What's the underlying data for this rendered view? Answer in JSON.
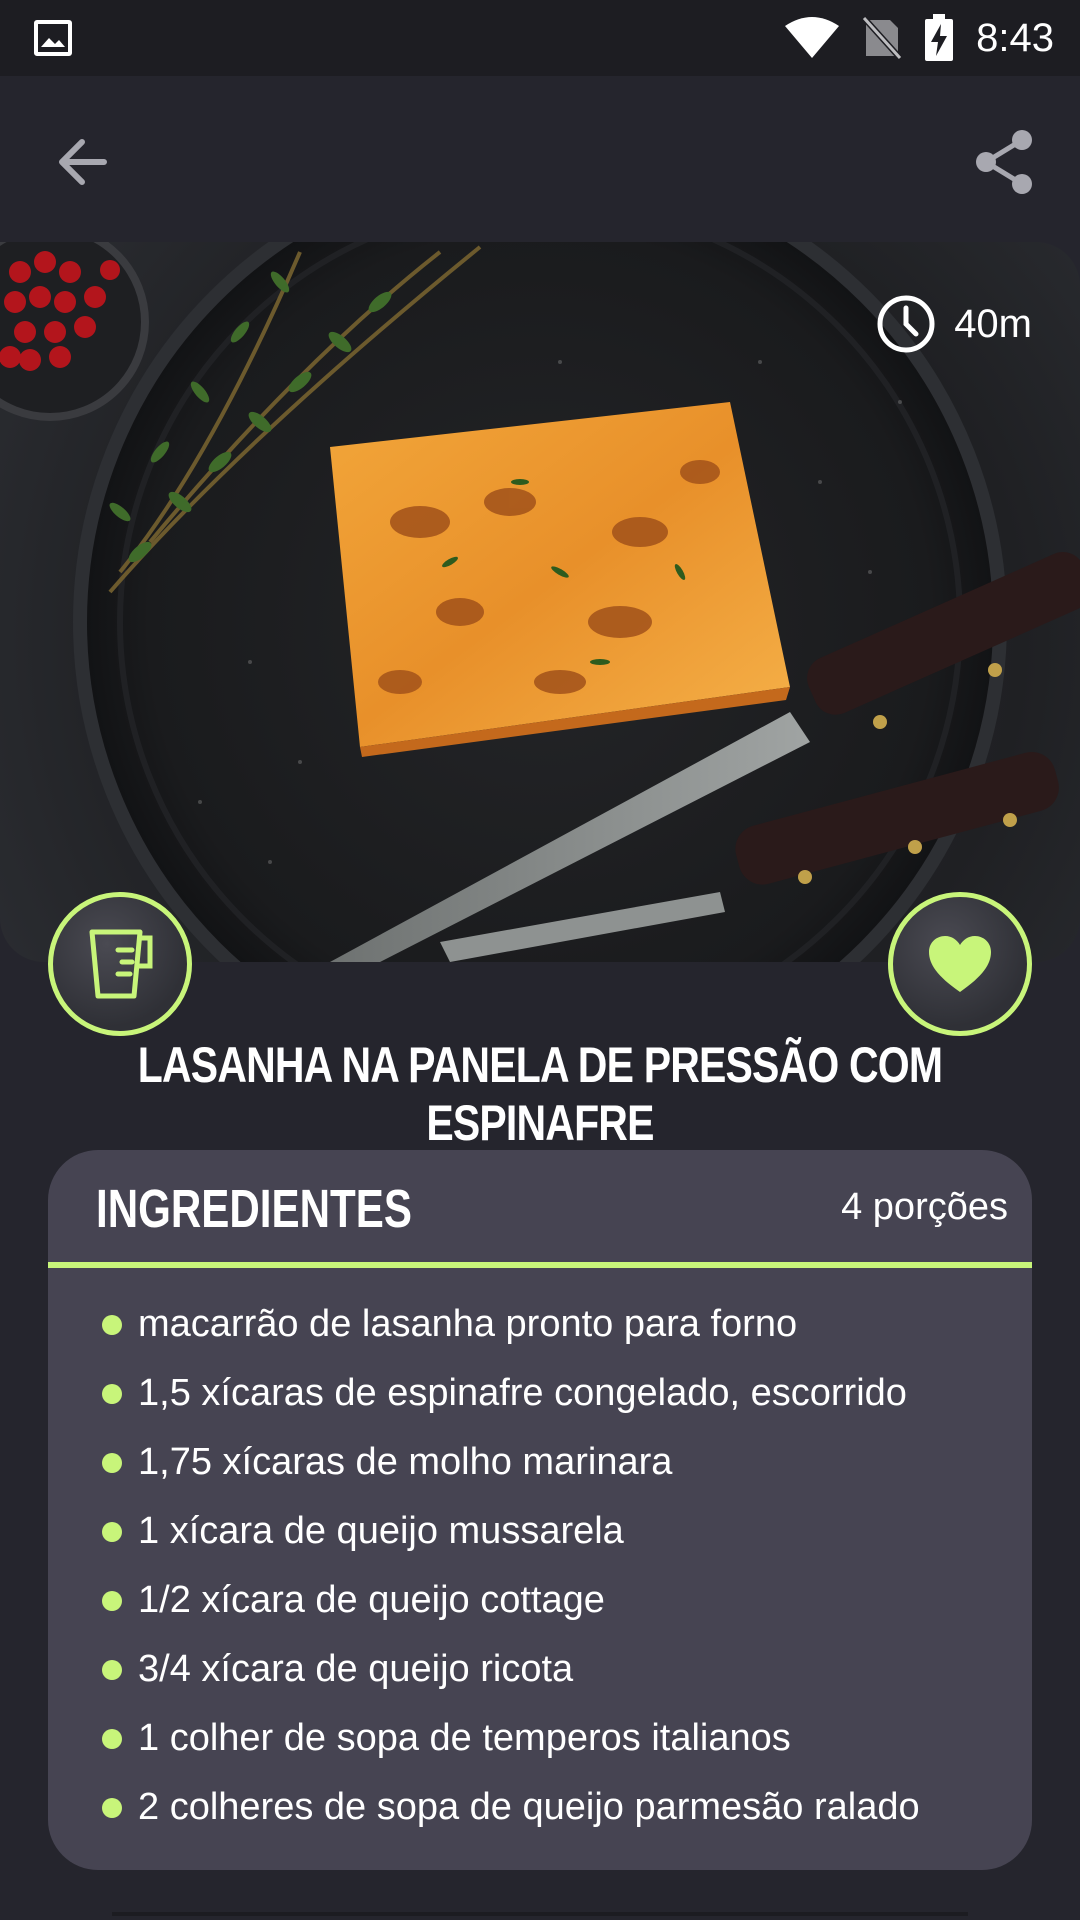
{
  "status_bar": {
    "time": "8:43",
    "icons": [
      "gallery-icon",
      "wifi-icon",
      "no-sim-icon",
      "battery-charging-icon"
    ]
  },
  "app_bar": {
    "back_icon": "arrow-left-icon",
    "share_icon": "share-icon"
  },
  "hero": {
    "time": "40m",
    "clock_icon": "clock-icon"
  },
  "actions": {
    "measure_icon": "measuring-cup-icon",
    "favorite_icon": "heart-icon"
  },
  "recipe": {
    "title": "LASANHA NA PANELA DE PRESSÃO COM ESPINAFRE"
  },
  "ingredients": {
    "heading": "INGREDIENTES",
    "servings": "4 porções",
    "items": [
      "macarrão de lasanha pronto para forno",
      "1,5 xícaras de espinafre congelado, escorrido",
      "1,75 xícaras de molho marinara",
      "1 xícara de queijo mussarela",
      "1/2 xícara de queijo cottage",
      "3/4 xícara de queijo ricota",
      "1 colher de sopa de temperos italianos",
      "2 colheres de sopa de queijo parmesão ralado"
    ]
  },
  "colors": {
    "background": "#25252d",
    "card": "#464452",
    "accent": "#c8f57a",
    "status_bar": "#1d1d22"
  }
}
